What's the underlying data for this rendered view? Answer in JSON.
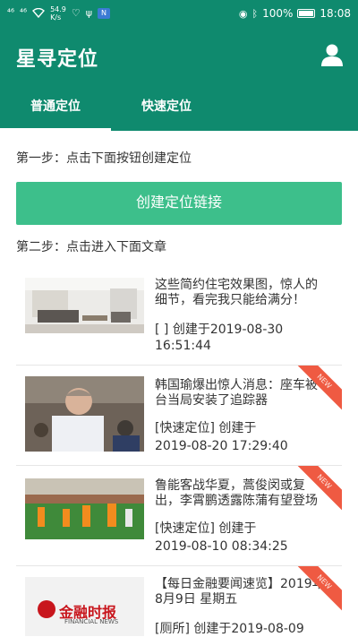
{
  "status_bar": {
    "signal_1": "⁴⁶",
    "signal_2": "⁴⁶",
    "net_speed_value": "54.9",
    "net_speed_unit": "K/s",
    "battery_percent": "100%",
    "time": "18:08"
  },
  "app": {
    "title": "星寻定位"
  },
  "tabs": [
    {
      "label": "普通定位",
      "active": true
    },
    {
      "label": "快速定位",
      "active": false
    }
  ],
  "steps": {
    "step1": "第一步：点击下面按钮创建定位",
    "button": "创建定位链接",
    "step2": "第二步：点击进入下面文章"
  },
  "articles": [
    {
      "title": "这些简约住宅效果图，惊人的细节，看完我只能给满分！",
      "meta_1": "[ ] 创建于2019-08-30",
      "meta_2": "16:51:44",
      "badge": ""
    },
    {
      "title": "韩国瑜爆出惊人消息：座车被台当局安装了追踪器",
      "meta_1": "[快速定位] 创建于",
      "meta_2": "2019-08-20 17:29:40",
      "badge": "NEW"
    },
    {
      "title": "鲁能客战华夏，蒿俊闵或复出，李霄鹏透露陈蒲有望登场",
      "meta_1": "[快速定位] 创建于",
      "meta_2": "2019-08-10 08:34:25",
      "badge": "NEW"
    },
    {
      "title": "【每日金融要闻速览】2019年8月9日 星期五",
      "meta_1": "[厕所] 创建于2019-08-09",
      "meta_2": "",
      "badge": "NEW",
      "logo_text": "金融时报",
      "logo_subtext": "FINANCIAL NEWS"
    }
  ],
  "colors": {
    "header": "#0f8a6e",
    "button": "#3dbf8b",
    "badge": "#ef5a42"
  }
}
